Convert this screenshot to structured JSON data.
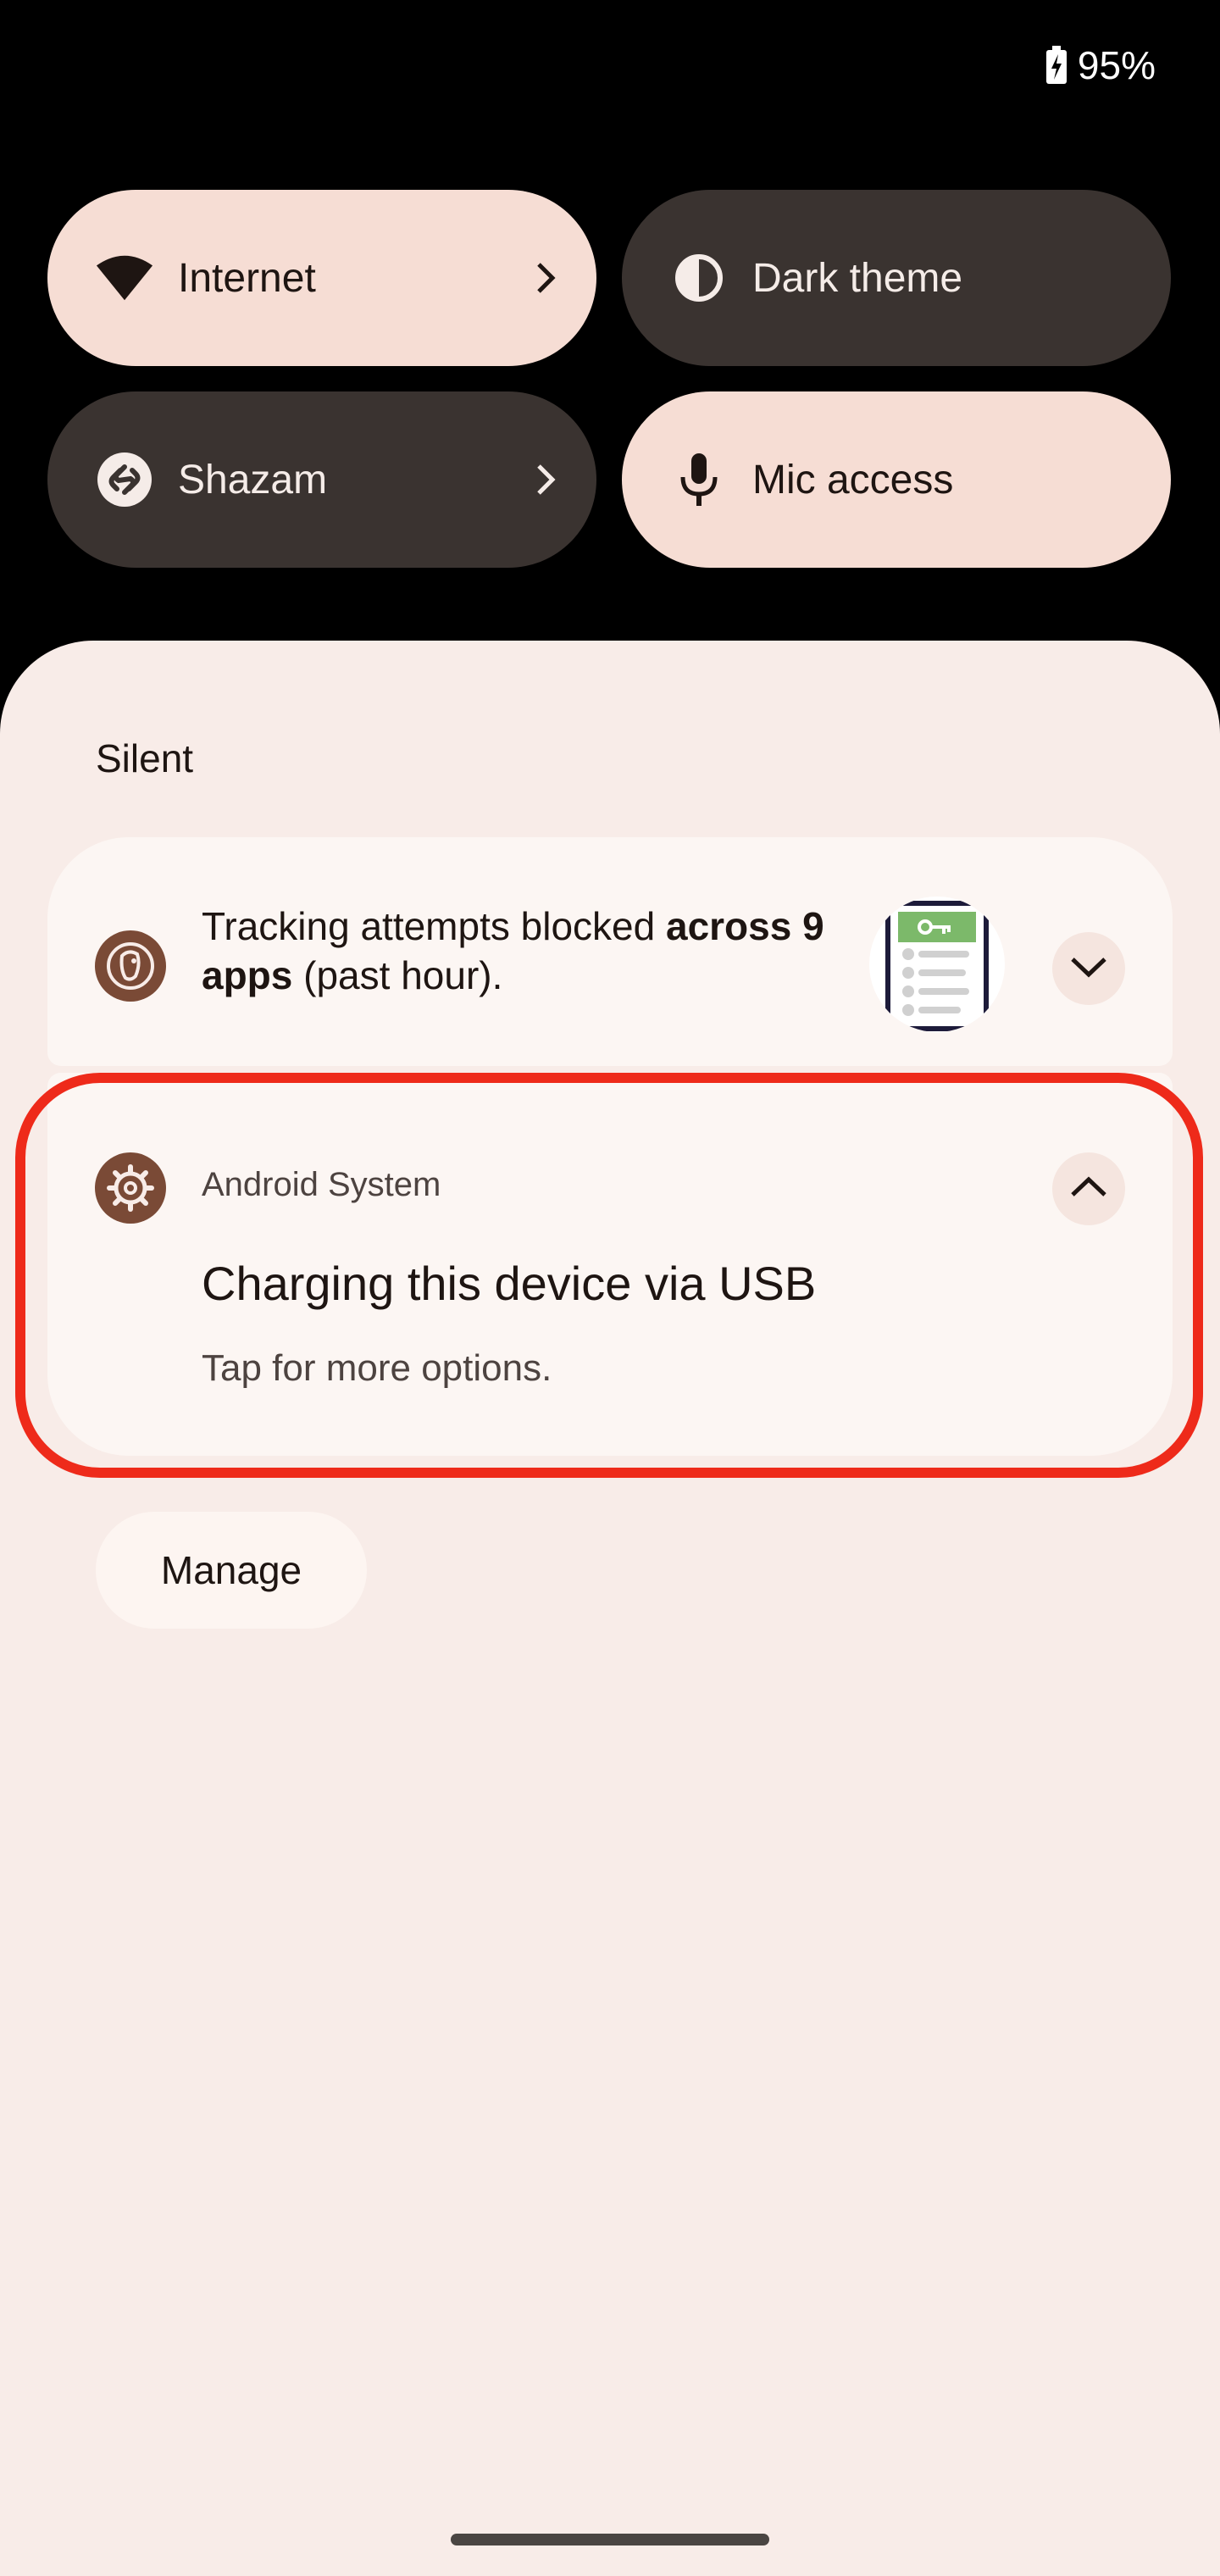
{
  "status_bar": {
    "battery_percent": "95%",
    "battery_icon": "battery-charging-icon"
  },
  "quick_settings": {
    "tiles": [
      {
        "label": "Internet",
        "icon": "wifi-icon",
        "active": true,
        "has_chevron": true
      },
      {
        "label": "Dark theme",
        "icon": "dark-theme-icon",
        "active": false,
        "has_chevron": false
      },
      {
        "label": "Shazam",
        "icon": "shazam-icon",
        "active": false,
        "has_chevron": true
      },
      {
        "label": "Mic access",
        "icon": "mic-icon",
        "active": true,
        "has_chevron": false
      }
    ]
  },
  "notifications": {
    "section_title": "Silent",
    "items": [
      {
        "app_icon": "duckduckgo-icon",
        "text_parts": [
          "Tracking attempts blocked ",
          "across 9 apps",
          " (past hour)."
        ],
        "thumbnail_icon": "app-list-illustration-icon",
        "expand_icon": "chevron-down-icon"
      },
      {
        "app_name": "Android System",
        "app_icon": "settings-gear-icon",
        "title": "Charging this device via USB",
        "body": "Tap for more options.",
        "expand_icon": "chevron-up-icon",
        "highlighted": true
      }
    ],
    "manage_label": "Manage"
  },
  "colors": {
    "background": "#000000",
    "tile_active": "#f6ddd4",
    "tile_inactive": "#3a3330",
    "shade": "#f8ece8",
    "card": "#fcf6f3",
    "app_icon": "#7a4a36",
    "highlight": "#ee2a1a"
  }
}
